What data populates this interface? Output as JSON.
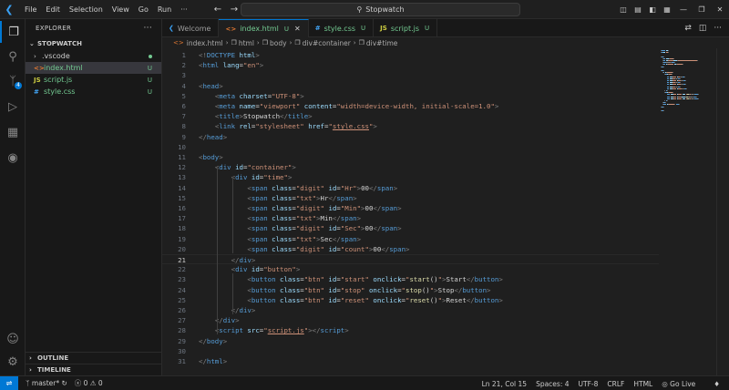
{
  "titlebar": {
    "menu": [
      "File",
      "Edit",
      "Selection",
      "View",
      "Go",
      "Run",
      "···"
    ],
    "search": "Stopwatch"
  },
  "sidebar": {
    "title": "EXPLORER",
    "project": "STOPWATCH",
    "files": [
      {
        "name": ".vscode",
        "status": "",
        "icon": "folder-icon"
      },
      {
        "name": "index.html",
        "status": "U",
        "icon": "html-file-icon"
      },
      {
        "name": "script.js",
        "status": "U",
        "icon": "js-file-icon"
      },
      {
        "name": "style.css",
        "status": "U",
        "icon": "css-file-icon"
      }
    ],
    "outline": "OUTLINE",
    "timeline": "TIMELINE"
  },
  "tabs": [
    {
      "label": "Welcome",
      "status": "",
      "icon": "vscode-icon"
    },
    {
      "label": "index.html",
      "status": "U",
      "icon": "html-file-icon"
    },
    {
      "label": "style.css",
      "status": "U",
      "icon": "css-file-icon"
    },
    {
      "label": "script.js",
      "status": "U",
      "icon": "js-file-icon"
    }
  ],
  "breadcrumb": [
    "index.html",
    "html",
    "body",
    "div#container",
    "div#time"
  ],
  "editor": {
    "current_line": 21,
    "lines": [
      [
        [
          "<!",
          "brk"
        ],
        [
          "DOCTYPE",
          "tag"
        ],
        [
          " ",
          "txt"
        ],
        [
          "html",
          "attr"
        ],
        [
          ">",
          "brk"
        ]
      ],
      [
        [
          "<",
          "brk"
        ],
        [
          "html",
          "tag"
        ],
        [
          " ",
          "txt"
        ],
        [
          "lang",
          "attr"
        ],
        [
          "=",
          "txt"
        ],
        [
          "\"en\"",
          "str"
        ],
        [
          ">",
          "brk"
        ]
      ],
      [],
      [
        [
          "<",
          "brk"
        ],
        [
          "head",
          "tag"
        ],
        [
          ">",
          "brk"
        ]
      ],
      [
        [
          "    ",
          "txt"
        ],
        [
          "<",
          "brk"
        ],
        [
          "meta",
          "tag"
        ],
        [
          " ",
          "txt"
        ],
        [
          "charset",
          "attr"
        ],
        [
          "=",
          "txt"
        ],
        [
          "\"UTF-8\"",
          "str"
        ],
        [
          ">",
          "brk"
        ]
      ],
      [
        [
          "    ",
          "txt"
        ],
        [
          "<",
          "brk"
        ],
        [
          "meta",
          "tag"
        ],
        [
          " ",
          "txt"
        ],
        [
          "name",
          "attr"
        ],
        [
          "=",
          "txt"
        ],
        [
          "\"viewport\"",
          "str"
        ],
        [
          " ",
          "txt"
        ],
        [
          "content",
          "attr"
        ],
        [
          "=",
          "txt"
        ],
        [
          "\"width=device-width, initial-scale=1.0\"",
          "str"
        ],
        [
          ">",
          "brk"
        ]
      ],
      [
        [
          "    ",
          "txt"
        ],
        [
          "<",
          "brk"
        ],
        [
          "title",
          "tag"
        ],
        [
          ">",
          "brk"
        ],
        [
          "Stopwatch",
          "txt"
        ],
        [
          "</",
          "brk"
        ],
        [
          "title",
          "tag"
        ],
        [
          ">",
          "brk"
        ]
      ],
      [
        [
          "    ",
          "txt"
        ],
        [
          "<",
          "brk"
        ],
        [
          "link",
          "tag"
        ],
        [
          " ",
          "txt"
        ],
        [
          "rel",
          "attr"
        ],
        [
          "=",
          "txt"
        ],
        [
          "\"stylesheet\"",
          "str"
        ],
        [
          " ",
          "txt"
        ],
        [
          "href",
          "attr"
        ],
        [
          "=",
          "txt"
        ],
        [
          "\"",
          "str"
        ],
        [
          "style.css",
          "strlnk"
        ],
        [
          "\"",
          "str"
        ],
        [
          ">",
          "brk"
        ]
      ],
      [
        [
          "</",
          "brk"
        ],
        [
          "head",
          "tag"
        ],
        [
          ">",
          "brk"
        ]
      ],
      [],
      [
        [
          "<",
          "brk"
        ],
        [
          "body",
          "tag"
        ],
        [
          ">",
          "brk"
        ]
      ],
      [
        [
          "    ",
          "txt"
        ],
        [
          "<",
          "brk"
        ],
        [
          "div",
          "tag"
        ],
        [
          " ",
          "txt"
        ],
        [
          "id",
          "attr"
        ],
        [
          "=",
          "txt"
        ],
        [
          "\"container\"",
          "str"
        ],
        [
          ">",
          "brk"
        ]
      ],
      [
        [
          "        ",
          "txt"
        ],
        [
          "<",
          "brk"
        ],
        [
          "div",
          "tag"
        ],
        [
          " ",
          "txt"
        ],
        [
          "id",
          "attr"
        ],
        [
          "=",
          "txt"
        ],
        [
          "\"time\"",
          "str"
        ],
        [
          ">",
          "brk"
        ]
      ],
      [
        [
          "            ",
          "txt"
        ],
        [
          "<",
          "brk"
        ],
        [
          "span",
          "tag"
        ],
        [
          " ",
          "txt"
        ],
        [
          "class",
          "attr"
        ],
        [
          "=",
          "txt"
        ],
        [
          "\"digit\"",
          "str"
        ],
        [
          " ",
          "txt"
        ],
        [
          "id",
          "attr"
        ],
        [
          "=",
          "txt"
        ],
        [
          "\"Hr\"",
          "str"
        ],
        [
          ">",
          "brk"
        ],
        [
          "00",
          "txt"
        ],
        [
          "</",
          "brk"
        ],
        [
          "span",
          "tag"
        ],
        [
          ">",
          "brk"
        ]
      ],
      [
        [
          "            ",
          "txt"
        ],
        [
          "<",
          "brk"
        ],
        [
          "span",
          "tag"
        ],
        [
          " ",
          "txt"
        ],
        [
          "class",
          "attr"
        ],
        [
          "=",
          "txt"
        ],
        [
          "\"txt\"",
          "str"
        ],
        [
          ">",
          "brk"
        ],
        [
          "Hr",
          "txt"
        ],
        [
          "</",
          "brk"
        ],
        [
          "span",
          "tag"
        ],
        [
          ">",
          "brk"
        ]
      ],
      [
        [
          "            ",
          "txt"
        ],
        [
          "<",
          "brk"
        ],
        [
          "span",
          "tag"
        ],
        [
          " ",
          "txt"
        ],
        [
          "class",
          "attr"
        ],
        [
          "=",
          "txt"
        ],
        [
          "\"digit\"",
          "str"
        ],
        [
          " ",
          "txt"
        ],
        [
          "id",
          "attr"
        ],
        [
          "=",
          "txt"
        ],
        [
          "\"Min\"",
          "str"
        ],
        [
          ">",
          "brk"
        ],
        [
          "00",
          "txt"
        ],
        [
          "</",
          "brk"
        ],
        [
          "span",
          "tag"
        ],
        [
          ">",
          "brk"
        ]
      ],
      [
        [
          "            ",
          "txt"
        ],
        [
          "<",
          "brk"
        ],
        [
          "span",
          "tag"
        ],
        [
          " ",
          "txt"
        ],
        [
          "class",
          "attr"
        ],
        [
          "=",
          "txt"
        ],
        [
          "\"txt\"",
          "str"
        ],
        [
          ">",
          "brk"
        ],
        [
          "Min",
          "txt"
        ],
        [
          "</",
          "brk"
        ],
        [
          "span",
          "tag"
        ],
        [
          ">",
          "brk"
        ]
      ],
      [
        [
          "            ",
          "txt"
        ],
        [
          "<",
          "brk"
        ],
        [
          "span",
          "tag"
        ],
        [
          " ",
          "txt"
        ],
        [
          "class",
          "attr"
        ],
        [
          "=",
          "txt"
        ],
        [
          "\"digit\"",
          "str"
        ],
        [
          " ",
          "txt"
        ],
        [
          "id",
          "attr"
        ],
        [
          "=",
          "txt"
        ],
        [
          "\"Sec\"",
          "str"
        ],
        [
          ">",
          "brk"
        ],
        [
          "00",
          "txt"
        ],
        [
          "</",
          "brk"
        ],
        [
          "span",
          "tag"
        ],
        [
          ">",
          "brk"
        ]
      ],
      [
        [
          "            ",
          "txt"
        ],
        [
          "<",
          "brk"
        ],
        [
          "span",
          "tag"
        ],
        [
          " ",
          "txt"
        ],
        [
          "class",
          "attr"
        ],
        [
          "=",
          "txt"
        ],
        [
          "\"txt\"",
          "str"
        ],
        [
          ">",
          "brk"
        ],
        [
          "Sec",
          "txt"
        ],
        [
          "</",
          "brk"
        ],
        [
          "span",
          "tag"
        ],
        [
          ">",
          "brk"
        ]
      ],
      [
        [
          "            ",
          "txt"
        ],
        [
          "<",
          "brk"
        ],
        [
          "span",
          "tag"
        ],
        [
          " ",
          "txt"
        ],
        [
          "class",
          "attr"
        ],
        [
          "=",
          "txt"
        ],
        [
          "\"digit\"",
          "str"
        ],
        [
          " ",
          "txt"
        ],
        [
          "id",
          "attr"
        ],
        [
          "=",
          "txt"
        ],
        [
          "\"count\"",
          "str"
        ],
        [
          ">",
          "brk"
        ],
        [
          "00",
          "txt"
        ],
        [
          "</",
          "brk"
        ],
        [
          "span",
          "tag"
        ],
        [
          ">",
          "brk"
        ]
      ],
      [
        [
          "        ",
          "txt"
        ],
        [
          "</",
          "brk"
        ],
        [
          "div",
          "tag"
        ],
        [
          ">",
          "brk"
        ]
      ],
      [
        [
          "        ",
          "txt"
        ],
        [
          "<",
          "brk"
        ],
        [
          "div",
          "tag"
        ],
        [
          " ",
          "txt"
        ],
        [
          "id",
          "attr"
        ],
        [
          "=",
          "txt"
        ],
        [
          "\"button\"",
          "str"
        ],
        [
          ">",
          "brk"
        ]
      ],
      [
        [
          "            ",
          "txt"
        ],
        [
          "<",
          "brk"
        ],
        [
          "button",
          "tag"
        ],
        [
          " ",
          "txt"
        ],
        [
          "class",
          "attr"
        ],
        [
          "=",
          "txt"
        ],
        [
          "\"btn\"",
          "str"
        ],
        [
          " ",
          "txt"
        ],
        [
          "id",
          "attr"
        ],
        [
          "=",
          "txt"
        ],
        [
          "\"start\"",
          "str"
        ],
        [
          " ",
          "txt"
        ],
        [
          "onclick",
          "attr"
        ],
        [
          "=",
          "txt"
        ],
        [
          "\"",
          "str"
        ],
        [
          "start",
          "fn"
        ],
        [
          "()",
          "txt"
        ],
        [
          "\"",
          "str"
        ],
        [
          ">",
          "brk"
        ],
        [
          "Start",
          "txt"
        ],
        [
          "</",
          "brk"
        ],
        [
          "button",
          "tag"
        ],
        [
          ">",
          "brk"
        ]
      ],
      [
        [
          "            ",
          "txt"
        ],
        [
          "<",
          "brk"
        ],
        [
          "button",
          "tag"
        ],
        [
          " ",
          "txt"
        ],
        [
          "class",
          "attr"
        ],
        [
          "=",
          "txt"
        ],
        [
          "\"btn\"",
          "str"
        ],
        [
          " ",
          "txt"
        ],
        [
          "id",
          "attr"
        ],
        [
          "=",
          "txt"
        ],
        [
          "\"stop\"",
          "str"
        ],
        [
          " ",
          "txt"
        ],
        [
          "onclick",
          "attr"
        ],
        [
          "=",
          "txt"
        ],
        [
          "\"",
          "str"
        ],
        [
          "stop",
          "fn"
        ],
        [
          "()",
          "txt"
        ],
        [
          "\"",
          "str"
        ],
        [
          ">",
          "brk"
        ],
        [
          "Stop",
          "txt"
        ],
        [
          "</",
          "brk"
        ],
        [
          "button",
          "tag"
        ],
        [
          ">",
          "brk"
        ]
      ],
      [
        [
          "            ",
          "txt"
        ],
        [
          "<",
          "brk"
        ],
        [
          "button",
          "tag"
        ],
        [
          " ",
          "txt"
        ],
        [
          "class",
          "attr"
        ],
        [
          "=",
          "txt"
        ],
        [
          "\"btn\"",
          "str"
        ],
        [
          " ",
          "txt"
        ],
        [
          "id",
          "attr"
        ],
        [
          "=",
          "txt"
        ],
        [
          "\"reset\"",
          "str"
        ],
        [
          " ",
          "txt"
        ],
        [
          "onclick",
          "attr"
        ],
        [
          "=",
          "txt"
        ],
        [
          "\"",
          "str"
        ],
        [
          "reset",
          "fn"
        ],
        [
          "()",
          "txt"
        ],
        [
          "\"",
          "str"
        ],
        [
          ">",
          "brk"
        ],
        [
          "Reset",
          "txt"
        ],
        [
          "</",
          "brk"
        ],
        [
          "button",
          "tag"
        ],
        [
          ">",
          "brk"
        ]
      ],
      [
        [
          "        ",
          "txt"
        ],
        [
          "</",
          "brk"
        ],
        [
          "div",
          "tag"
        ],
        [
          ">",
          "brk"
        ]
      ],
      [
        [
          "    ",
          "txt"
        ],
        [
          "</",
          "brk"
        ],
        [
          "div",
          "tag"
        ],
        [
          ">",
          "brk"
        ]
      ],
      [
        [
          "    ",
          "txt"
        ],
        [
          "<",
          "brk"
        ],
        [
          "script",
          "tag"
        ],
        [
          " ",
          "txt"
        ],
        [
          "src",
          "attr"
        ],
        [
          "=",
          "txt"
        ],
        [
          "\"",
          "str"
        ],
        [
          "script.js",
          "strlnk"
        ],
        [
          "\"",
          "str"
        ],
        [
          "></",
          "brk"
        ],
        [
          "script",
          "tag"
        ],
        [
          ">",
          "brk"
        ]
      ],
      [
        [
          "</",
          "brk"
        ],
        [
          "body",
          "tag"
        ],
        [
          ">",
          "brk"
        ]
      ],
      [],
      [
        [
          "</",
          "brk"
        ],
        [
          "html",
          "tag"
        ],
        [
          ">",
          "brk"
        ]
      ]
    ]
  },
  "statusbar": {
    "branch": "master*",
    "problems": "ⓧ 0 ⚠ 0",
    "position": "Ln 21, Col 15",
    "spaces": "Spaces: 4",
    "encoding": "UTF-8",
    "eol": "CRLF",
    "language": "HTML",
    "golive": "Go Live"
  },
  "colors": {
    "accent": "#0078d4",
    "untracked": "#73c991",
    "tag": "#569cd6",
    "attr": "#9cdcfe",
    "string": "#ce9178"
  }
}
